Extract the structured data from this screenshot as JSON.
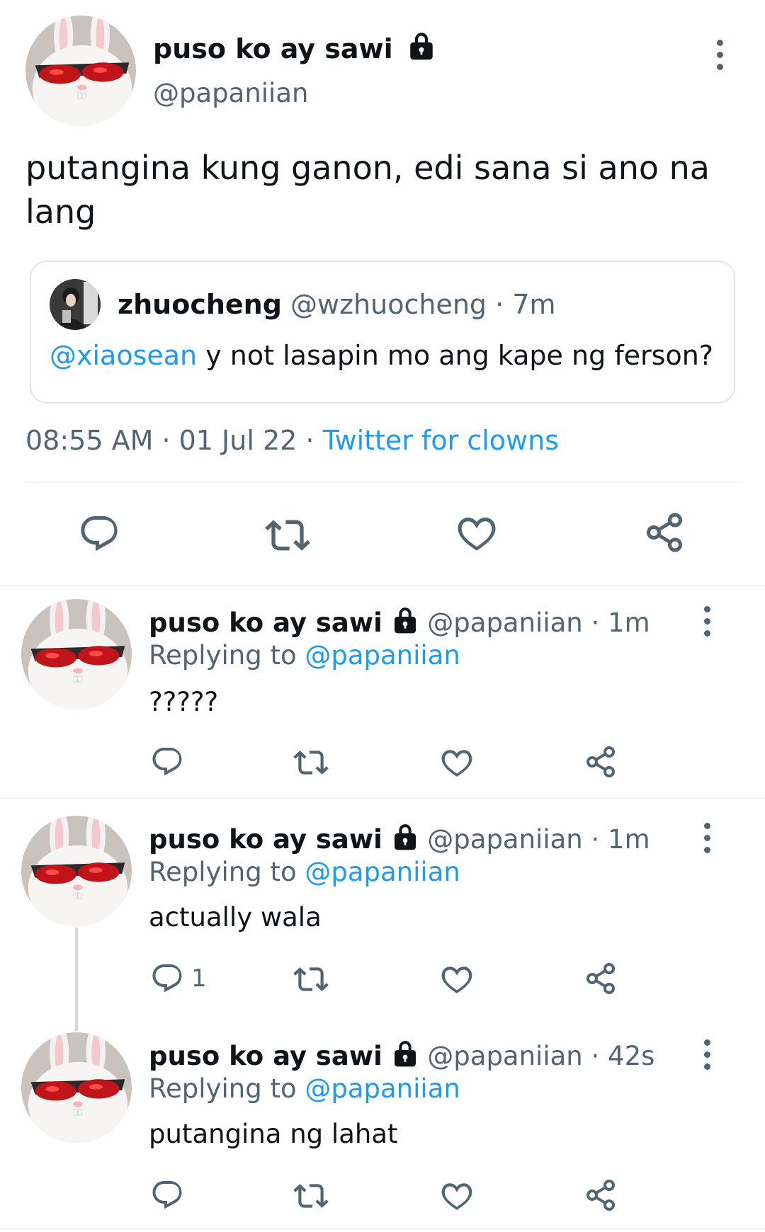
{
  "main_tweet": {
    "name": "puso ko ay sawi",
    "handle": "@papaniian",
    "text": "putangina kung ganon, edi sana si ano na lang",
    "quote": {
      "name": "zhuocheng",
      "handle": "@wzhuocheng",
      "separator": "·",
      "time": "7m",
      "mention": "@xiaosean",
      "text": " y not lasapin mo ang kape ng ferson?"
    },
    "timestamp": "08:55 AM · 01 Jul 22 · ",
    "source": "Twitter for clowns"
  },
  "replies": [
    {
      "name": "puso ko ay sawi",
      "handle": "@papaniian",
      "separator": " · ",
      "time": "1m",
      "replying_prefix": "Replying to ",
      "replying_to": "@papaniian",
      "text": "?????",
      "reply_count": ""
    },
    {
      "name": "puso ko ay sawi",
      "handle": "@papaniian",
      "separator": " · ",
      "time": "1m",
      "replying_prefix": "Replying to ",
      "replying_to": "@papaniian",
      "text": "actually wala",
      "reply_count": "1"
    },
    {
      "name": "puso ko ay sawi",
      "handle": "@papaniian",
      "separator": " · ",
      "time": "42s",
      "replying_prefix": "Replying to ",
      "replying_to": "@papaniian",
      "text": "putangina ng lahat",
      "reply_count": ""
    }
  ],
  "icons": {
    "reply": "reply-icon",
    "retweet": "retweet-icon",
    "like": "heart-icon",
    "share": "share-icon",
    "lock": "lock-icon",
    "more": "more-vertical-icon"
  },
  "colors": {
    "accent": "#1d9bf0",
    "secondary_text": "#536471",
    "divider": "#eff3f4"
  }
}
